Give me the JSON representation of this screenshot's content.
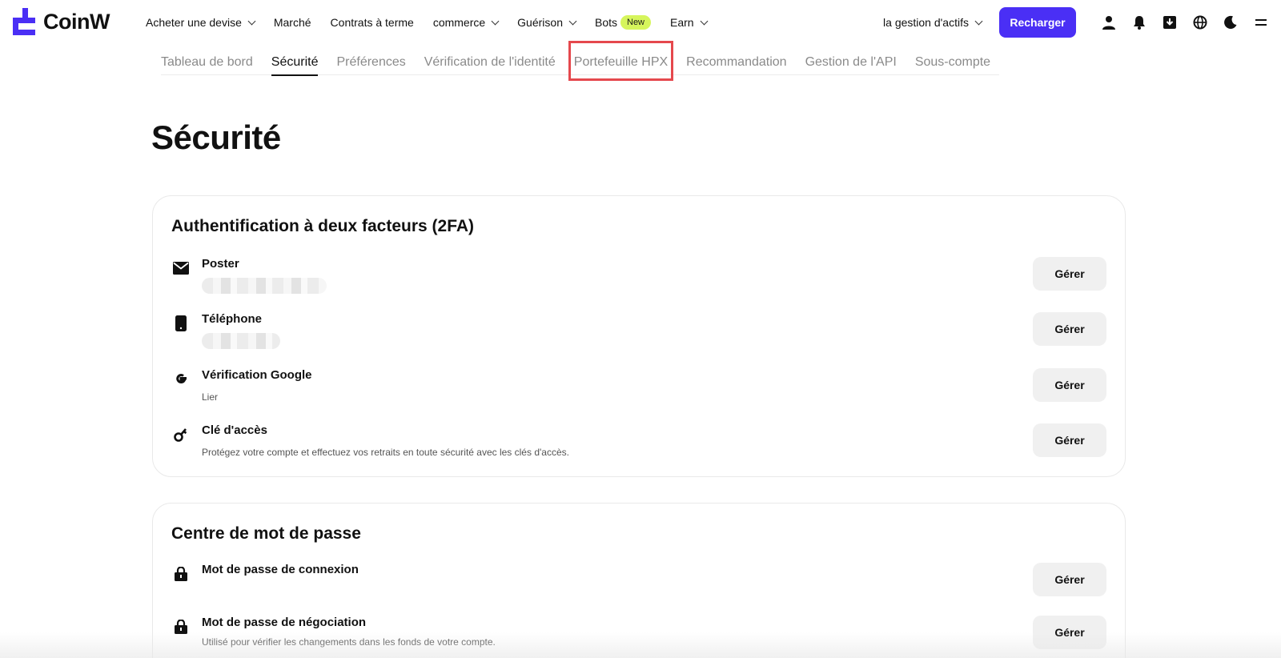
{
  "brand": {
    "name": "CoinW",
    "accent": "#4a2ff5"
  },
  "nav": {
    "items": [
      {
        "label": "Acheter une devise",
        "dropdown": true
      },
      {
        "label": "Marché",
        "dropdown": false
      },
      {
        "label": "Contrats à terme",
        "dropdown": false
      },
      {
        "label": "commerce",
        "dropdown": true
      },
      {
        "label": "Guérison",
        "dropdown": true
      },
      {
        "label": "Bots",
        "dropdown": false,
        "badge": "New"
      },
      {
        "label": "Earn",
        "dropdown": true
      }
    ],
    "asset_menu": "la gestion d'actifs",
    "recharge_label": "Recharger",
    "icons": [
      "user-icon",
      "bell-icon",
      "download-icon",
      "globe-icon",
      "moon-icon",
      "menu-icon"
    ]
  },
  "subtabs": [
    {
      "label": "Tableau de bord",
      "active": false
    },
    {
      "label": "Sécurité",
      "active": true
    },
    {
      "label": "Préférences",
      "active": false
    },
    {
      "label": "Vérification de l'identité",
      "active": false
    },
    {
      "label": "Portefeuille HPX",
      "active": false,
      "highlighted": true
    },
    {
      "label": "Recommandation",
      "active": false
    },
    {
      "label": "Gestion de l'API",
      "active": false
    },
    {
      "label": "Sous-compte",
      "active": false
    }
  ],
  "page_title": "Sécurité",
  "twofa": {
    "title": "Authentification à deux facteurs (2FA)",
    "rows": [
      {
        "icon": "mail-icon",
        "label": "Poster",
        "sub": "",
        "redacted": true,
        "button": "Gérer"
      },
      {
        "icon": "phone-icon",
        "label": "Téléphone",
        "sub": "",
        "redacted": true,
        "button": "Gérer"
      },
      {
        "icon": "google-icon",
        "label": "Vérification Google",
        "sub": "Lier",
        "button": "Gérer"
      },
      {
        "icon": "key-icon",
        "label": "Clé d'accès",
        "sub": "Protégez votre compte et effectuez vos retraits en toute sécurité avec les clés d'accès.",
        "button": "Gérer"
      }
    ]
  },
  "password_center": {
    "title": "Centre de mot de passe",
    "rows": [
      {
        "icon": "lock-icon",
        "label": "Mot de passe de connexion",
        "sub": "",
        "button": "Gérer"
      },
      {
        "icon": "lock-icon",
        "label": "Mot de passe de négociation",
        "sub": "Utilisé pour vérifier les changements dans les fonds de votre compte.",
        "button": "Gérer"
      }
    ]
  }
}
